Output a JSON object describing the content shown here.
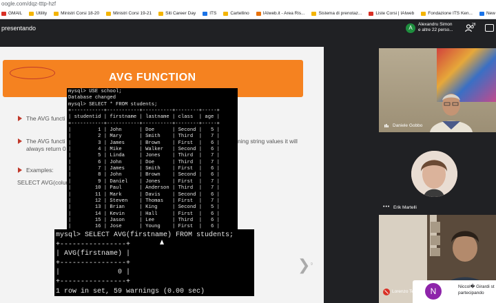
{
  "browser": {
    "url": "oogle.com/dqz-tttp-hzf",
    "bookmarks": [
      {
        "label": "GMAIL",
        "color": "red"
      },
      {
        "label": "Utility",
        "color": "yellow"
      },
      {
        "label": "Ministri Corsi 18-20",
        "color": "yellow"
      },
      {
        "label": "Ministri Corsi 19-21",
        "color": "yellow"
      },
      {
        "label": "Siti Career Day",
        "color": "yellow"
      },
      {
        "label": "ITS",
        "color": "blue"
      },
      {
        "label": "Cartellino",
        "color": "yellow"
      },
      {
        "label": "IAIweb.it - Area Ris...",
        "color": "orange"
      },
      {
        "label": "Sistema di prenotaz...",
        "color": "yellow"
      },
      {
        "label": "Liste Corsi | IAIweb",
        "color": "red"
      },
      {
        "label": "Fondazione ITS Ken...",
        "color": "yellow"
      },
      {
        "label": "New Tab",
        "color": "blue"
      },
      {
        "label": "Drive Pagine",
        "color": "yellow"
      },
      {
        "label": "DuckDuckGo —",
        "color": "orange"
      }
    ]
  },
  "meet": {
    "status": "presentando",
    "presenter_initial": "A",
    "presenter_line1": "Alexandru Simon",
    "presenter_line2": "e altre 22 perso...",
    "people_count": "28"
  },
  "slide": {
    "title": "AVG  FUNCTION",
    "bullet1": "The AVG functi",
    "bullet2_start": "The AVG functi",
    "bullet2_end": "ning string values it will",
    "bullet2_line2": "always return 0",
    "examples": "Examples:",
    "example_code": "SELECT AVG(colum",
    "next_symbol": "❯",
    "page_number": "9"
  },
  "terminal_top": {
    "lines": [
      "mysql> USE school;",
      "Database changed",
      "mysql> SELECT * FROM students;",
      "+-----------+-----------+----------+--------+-----+",
      "| studentid | firstname | lastname | class  | age |",
      "+-----------+-----------+----------+--------+-----+",
      "|         1 | John      | Doe      | Second |   5 |",
      "|         2 | Mary      | Smith    | Third  |   7 |",
      "|         3 | James     | Brown    | First  |   6 |",
      "|         4 | Mike      | Walker   | Second |   6 |",
      "|         5 | Linda     | Jones    | Third  |   7 |",
      "|         6 | John      | Doe      | Third  |   7 |",
      "|         7 | James     | Smith    | First  |   6 |",
      "|         8 | John      | Brown    | Second |   6 |",
      "|         9 | Daniel    | Jones    | First  |   7 |",
      "|        10 | Paul      | Anderson | Third  |   7 |",
      "|        11 | Mark      | Davis    | Second |   6 |",
      "|        12 | Steven    | Thomas   | First  |   7 |",
      "|        13 | Brian     | King     | Second |   5 |",
      "|        14 | Kevin     | Hall     | First  |   6 |",
      "|        15 | Jason     | Lee      | Third  |   6 |",
      "|        16 | Jose      | Young    | First  |   6 |"
    ]
  },
  "terminal_bottom": {
    "lines": [
      "mysql> SELECT AVG(firstname) FROM students;",
      "+----------------+",
      "| AVG(firstname) |",
      "+----------------+",
      "|              0 |",
      "+----------------+",
      "1 row in set, 59 warnings (0.00 sec)"
    ]
  },
  "participants": [
    {
      "name": "Daniele Gobbo"
    },
    {
      "name": "Erik Martelli"
    },
    {
      "name": "Lorenzo Te"
    }
  ],
  "toast": {
    "initial": "N",
    "line1": "Niccol� Girardi st",
    "line2": "partecipando"
  },
  "colors": {
    "slide_banner": "#f58220",
    "meet_background": "#202124",
    "bullet_arrow": "#c0392b"
  }
}
